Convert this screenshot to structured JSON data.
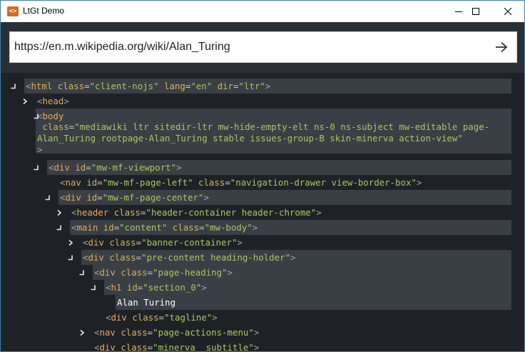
{
  "window": {
    "title": "LtGt Demo",
    "app_icon_glyph": "<>",
    "controls": [
      "minimize-icon",
      "maximize-icon",
      "close-icon"
    ]
  },
  "address": {
    "url": "https://en.m.wikipedia.org/wiki/Alan_Turing",
    "go_icon": "arrow-right-icon"
  },
  "colors": {
    "bracket": "#a0a4aa",
    "tag": "#e5a85a",
    "attr_name": "#d4b35a",
    "attr_value": "#a5c860",
    "text": "#ffffff",
    "row_highlight": "#3a3f46",
    "background": "#1e2227"
  },
  "nodes": [
    {
      "id": "n-html",
      "toggle": "collapse",
      "open": "<",
      "tag": "html",
      "attrs": [
        {
          "n": "class",
          "v": "\"client-nojs\""
        },
        {
          "n": "lang",
          "v": "\"en\""
        },
        {
          "n": "dir",
          "v": "\"ltr\""
        }
      ],
      "close": ">"
    },
    {
      "id": "n-head",
      "toggle": "expand",
      "open": "<",
      "tag": "head",
      "attrs": [],
      "close": ">"
    },
    {
      "id": "n-body",
      "toggle": "collapse",
      "open": "<",
      "tag": "body",
      "attrs": [],
      "close": "",
      "attr_line_1": "class=\"mediawiki ltr sitedir-ltr mw-hide-empty-elt ns-0 ns-subject mw-editable page-",
      "attr_line_2": "Alan_Turing rootpage-Alan_Turing stable issues-group-B skin-minerva action-view\"",
      "close_line": ">"
    },
    {
      "id": "n-viewport",
      "toggle": "collapse",
      "open": "<",
      "tag": "div",
      "attrs": [
        {
          "n": "id",
          "v": "\"mw-mf-viewport\""
        }
      ],
      "close": ">"
    },
    {
      "id": "n-nav-left",
      "toggle": "none",
      "open": "<",
      "tag": "nav",
      "attrs": [
        {
          "n": "id",
          "v": "\"mw-mf-page-left\""
        },
        {
          "n": "class",
          "v": "\"navigation-drawer view-border-box\""
        }
      ],
      "close": ">"
    },
    {
      "id": "n-page-center",
      "toggle": "collapse",
      "open": "<",
      "tag": "div",
      "attrs": [
        {
          "n": "id",
          "v": "\"mw-mf-page-center\""
        }
      ],
      "close": ">"
    },
    {
      "id": "n-header",
      "toggle": "expand",
      "open": "<",
      "tag": "header",
      "attrs": [
        {
          "n": "class",
          "v": "\"header-container header-chrome\""
        }
      ],
      "close": ">"
    },
    {
      "id": "n-main",
      "toggle": "collapse",
      "open": "<",
      "tag": "main",
      "attrs": [
        {
          "n": "id",
          "v": "\"content\""
        },
        {
          "n": "class",
          "v": "\"mw-body\""
        }
      ],
      "close": ">"
    },
    {
      "id": "n-banner",
      "toggle": "expand",
      "open": "<",
      "tag": "div",
      "attrs": [
        {
          "n": "class",
          "v": "\"banner-container\""
        }
      ],
      "close": ">"
    },
    {
      "id": "n-precontent",
      "toggle": "collapse",
      "open": "<",
      "tag": "div",
      "attrs": [
        {
          "n": "class",
          "v": "\"pre-content heading-holder\""
        }
      ],
      "close": ">"
    },
    {
      "id": "n-heading",
      "toggle": "collapse",
      "open": "<",
      "tag": "div",
      "attrs": [
        {
          "n": "class",
          "v": "\"page-heading\""
        }
      ],
      "close": ">"
    },
    {
      "id": "n-h1",
      "toggle": "collapse",
      "open": "<",
      "tag": "h1",
      "attrs": [
        {
          "n": "id",
          "v": "\"section_0\""
        }
      ],
      "close": ">"
    },
    {
      "id": "n-h1-text",
      "toggle": "none",
      "text": "Alan Turing"
    },
    {
      "id": "n-tagline",
      "toggle": "none",
      "open": "<",
      "tag": "div",
      "attrs": [
        {
          "n": "class",
          "v": "\"tagline\""
        }
      ],
      "close": ">"
    },
    {
      "id": "n-actions",
      "toggle": "expand",
      "open": "<",
      "tag": "nav",
      "attrs": [
        {
          "n": "class",
          "v": "\"page-actions-menu\""
        }
      ],
      "close": ">"
    },
    {
      "id": "n-subtitle",
      "toggle": "none",
      "open": "<",
      "tag": "div",
      "attrs": [
        {
          "n": "class",
          "v": "\"minerva__subtitle\""
        }
      ],
      "close": ">"
    }
  ]
}
